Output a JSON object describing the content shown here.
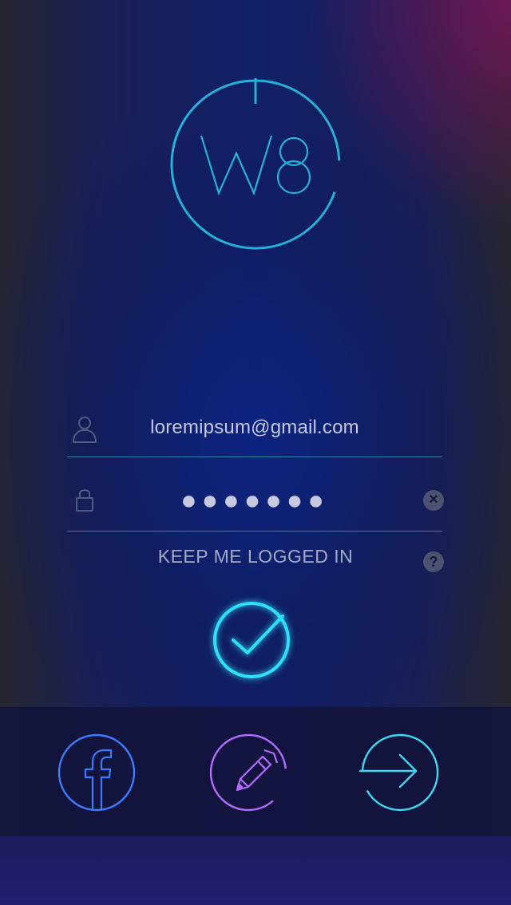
{
  "logo": {
    "text": "W8",
    "color": "#27b1d8"
  },
  "login_form": {
    "email_value": "loremipsum@gmail.com",
    "password_masked": "●●●●●●●",
    "clear_label": "×",
    "keep_logged_in_label": "KEEP ME LOGGED IN",
    "help_label": "?"
  },
  "icons": {
    "user": "user-icon",
    "lock": "lock-icon",
    "clear": "clear-icon",
    "help": "help-icon",
    "check": "check-icon",
    "facebook": "facebook-icon",
    "pencil": "pencil-icon",
    "arrow": "arrow-right-icon"
  },
  "colors": {
    "accent_cyan": "#2ee0ff",
    "facebook_blue": "#3a7bff",
    "signup_purple": "#b36bff",
    "next_cyan": "#3dd8f0",
    "text_light": "#c6c9e0",
    "muted": "#4c5270"
  }
}
